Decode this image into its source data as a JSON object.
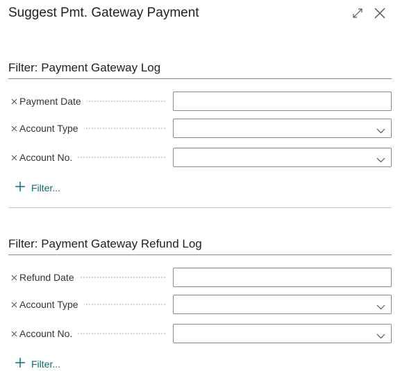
{
  "dialog": {
    "title": "Suggest Pmt. Gateway Payment",
    "expand_icon": "expand-icon",
    "close_icon": "close-icon"
  },
  "sections": [
    {
      "header": "Filter: Payment Gateway Log",
      "rows": [
        {
          "label": "Payment Date",
          "type": "text",
          "value": ""
        },
        {
          "label": "Account Type",
          "type": "select",
          "value": ""
        },
        {
          "label": "Account No.",
          "type": "select",
          "value": ""
        }
      ],
      "add_filter_label": "Filter..."
    },
    {
      "header": "Filter: Payment Gateway Refund Log",
      "rows": [
        {
          "label": "Refund Date",
          "type": "text",
          "value": ""
        },
        {
          "label": "Account Type",
          "type": "select",
          "value": ""
        },
        {
          "label": "Account No.",
          "type": "select",
          "value": ""
        }
      ],
      "add_filter_label": "Filter..."
    }
  ],
  "colors": {
    "accent": "#00707a",
    "border": "#8a8a8a",
    "text": "#212121"
  }
}
